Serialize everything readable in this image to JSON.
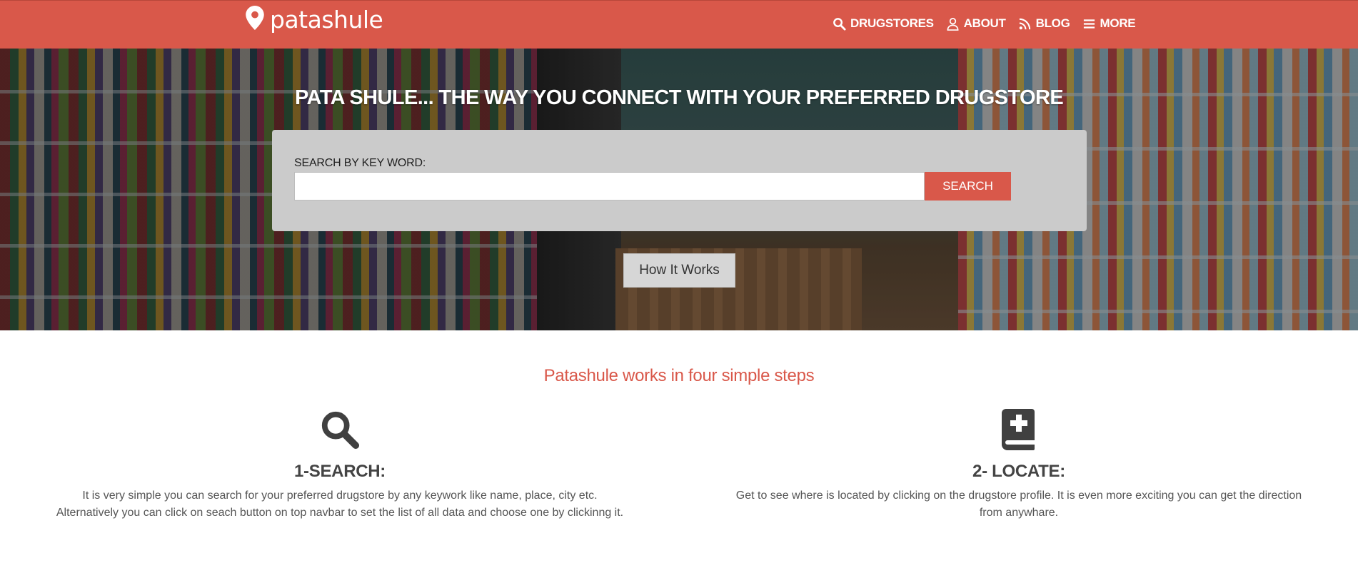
{
  "navbar": {
    "brand": "patashule",
    "items": [
      {
        "label": "DRUGSTORES",
        "icon": "search-icon"
      },
      {
        "label": "ABOUT",
        "icon": "user-icon"
      },
      {
        "label": "BLOG",
        "icon": "rss-icon"
      },
      {
        "label": "MORE",
        "icon": "menu-icon"
      }
    ]
  },
  "hero": {
    "title": "PATA SHULE... THE WAY YOU CONNECT WITH YOUR PREFERRED DRUGSTORE",
    "search_label": "SEARCH BY KEY WORD:",
    "search_value": "",
    "search_button": "SEARCH",
    "how_button": "How It Works"
  },
  "steps": {
    "title": "Patashule works in four simple steps",
    "items": [
      {
        "icon": "search-icon",
        "title": "1-SEARCH:",
        "text": "It is very simple you can search for your preferred drugstore by any keywork like name, place, city etc. Alternatively you can click on seach button on top navbar to set the list of all data and choose one by clickinng it."
      },
      {
        "icon": "medical-book-icon",
        "title": "2- LOCATE:",
        "text": "Get to see where is located by clicking on the drugstore profile. It is even more exciting you can get the direction from anywhare."
      }
    ]
  },
  "colors": {
    "accent": "#d9584a",
    "panel": "#cbcbcb"
  }
}
